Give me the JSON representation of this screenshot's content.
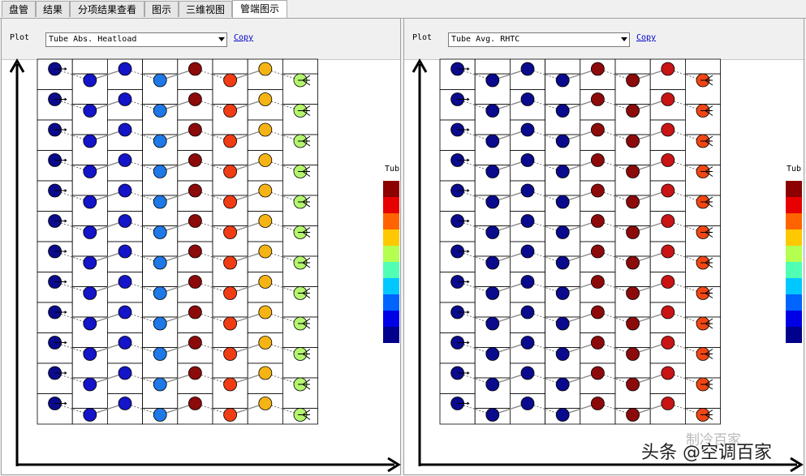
{
  "tabs": [
    {
      "label": "盘管",
      "active": false
    },
    {
      "label": "结果",
      "active": false
    },
    {
      "label": "分项结果查看",
      "active": false
    },
    {
      "label": "图示",
      "active": false
    },
    {
      "label": "三维视图",
      "active": false
    },
    {
      "label": "管端图示",
      "active": true
    }
  ],
  "panels": [
    {
      "plot_label": "Plot",
      "plot_selection": "Tube Abs. Heatload",
      "copy_label": "Copy",
      "legend_title": "Tub",
      "columns": 8,
      "rows": 12,
      "column_colors": [
        "#0a0a8c",
        "#1414c8",
        "#1414c8",
        "#1e78e6",
        "#8c0a0a",
        "#f03c14",
        "#f5b414",
        "#b4f56e"
      ]
    },
    {
      "plot_label": "Plot",
      "plot_selection": "Tube Avg. RHTC",
      "copy_label": "Copy",
      "legend_title": "Tub",
      "columns": 8,
      "rows": 12,
      "column_colors": [
        "#0a0a8c",
        "#0a0a8c",
        "#0a0a8c",
        "#0a0a8c",
        "#8c0a0a",
        "#8c0a0a",
        "#c81414",
        "#f04614"
      ]
    }
  ],
  "legend_colors": [
    "#8c0000",
    "#e60000",
    "#ff6400",
    "#ffc800",
    "#b4ff50",
    "#50ffb4",
    "#00c8ff",
    "#0064ff",
    "#0000e6",
    "#00008c"
  ],
  "watermark": {
    "main": "头条 @空调百家",
    "secondary": "制冷百家"
  }
}
